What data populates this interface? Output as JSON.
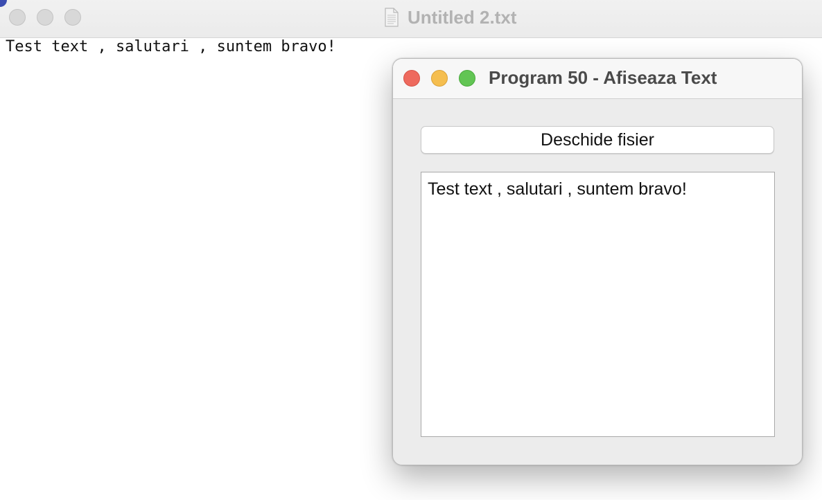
{
  "editor": {
    "title": "Untitled 2.txt",
    "content": "Test text , salutari , suntem bravo!",
    "icons": {
      "document": "document-icon"
    }
  },
  "dialog": {
    "title": "Program 50 - Afiseaza Text",
    "open_button_label": "Deschide fisier",
    "text_area_content": "Test text , salutari , suntem bravo!",
    "colors": {
      "close": "#ee6a5e",
      "minimize": "#f5be4f",
      "zoom": "#62c554"
    }
  }
}
